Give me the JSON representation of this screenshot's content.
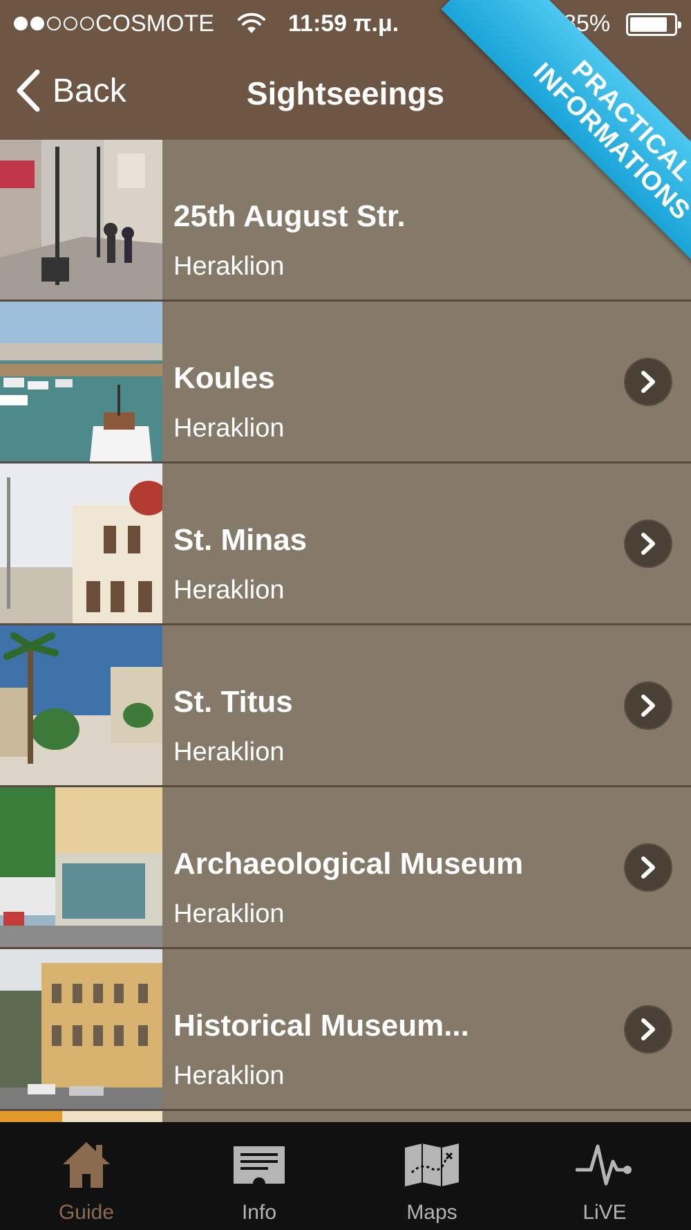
{
  "status_bar": {
    "carrier": "COSMOTE",
    "time": "11:59 π.μ.",
    "battery_percent": "85%",
    "signal_bars_filled": 2,
    "signal_bars_total": 5
  },
  "nav": {
    "back_label": "Back",
    "title": "Sightseeings"
  },
  "ribbon": {
    "line1": "PRACTICAL",
    "line2": "INFORMATIONS",
    "color": "#29aee1"
  },
  "list": {
    "items": [
      {
        "title": "25th August Str.",
        "subtitle": "Heraklion",
        "thumb": "street-photo",
        "has_disclosure": false
      },
      {
        "title": "Koules",
        "subtitle": "Heraklion",
        "thumb": "harbor-photo",
        "has_disclosure": true
      },
      {
        "title": "St. Minas",
        "subtitle": "Heraklion",
        "thumb": "church-photo",
        "has_disclosure": true
      },
      {
        "title": "St. Titus",
        "subtitle": "Heraklion",
        "thumb": "palm-square-photo",
        "has_disclosure": true
      },
      {
        "title": "Archaeological Museum",
        "subtitle": "Heraklion",
        "thumb": "museum-photo",
        "has_disclosure": true
      },
      {
        "title": "Historical Museum...",
        "subtitle": "Heraklion",
        "thumb": "historical-building-photo",
        "has_disclosure": true
      }
    ]
  },
  "tabbar": {
    "tabs": [
      {
        "label": "Guide",
        "icon": "house-icon",
        "active": true
      },
      {
        "label": "Info",
        "icon": "ticket-icon",
        "active": false
      },
      {
        "label": "Maps",
        "icon": "map-icon",
        "active": false
      },
      {
        "label": "LiVE",
        "icon": "pulse-icon",
        "active": false
      }
    ]
  },
  "colors": {
    "nav_background": "#6d5644",
    "row_background": "#857a69",
    "tabbar_background": "#111111",
    "active_tab": "#8a6b4d"
  }
}
